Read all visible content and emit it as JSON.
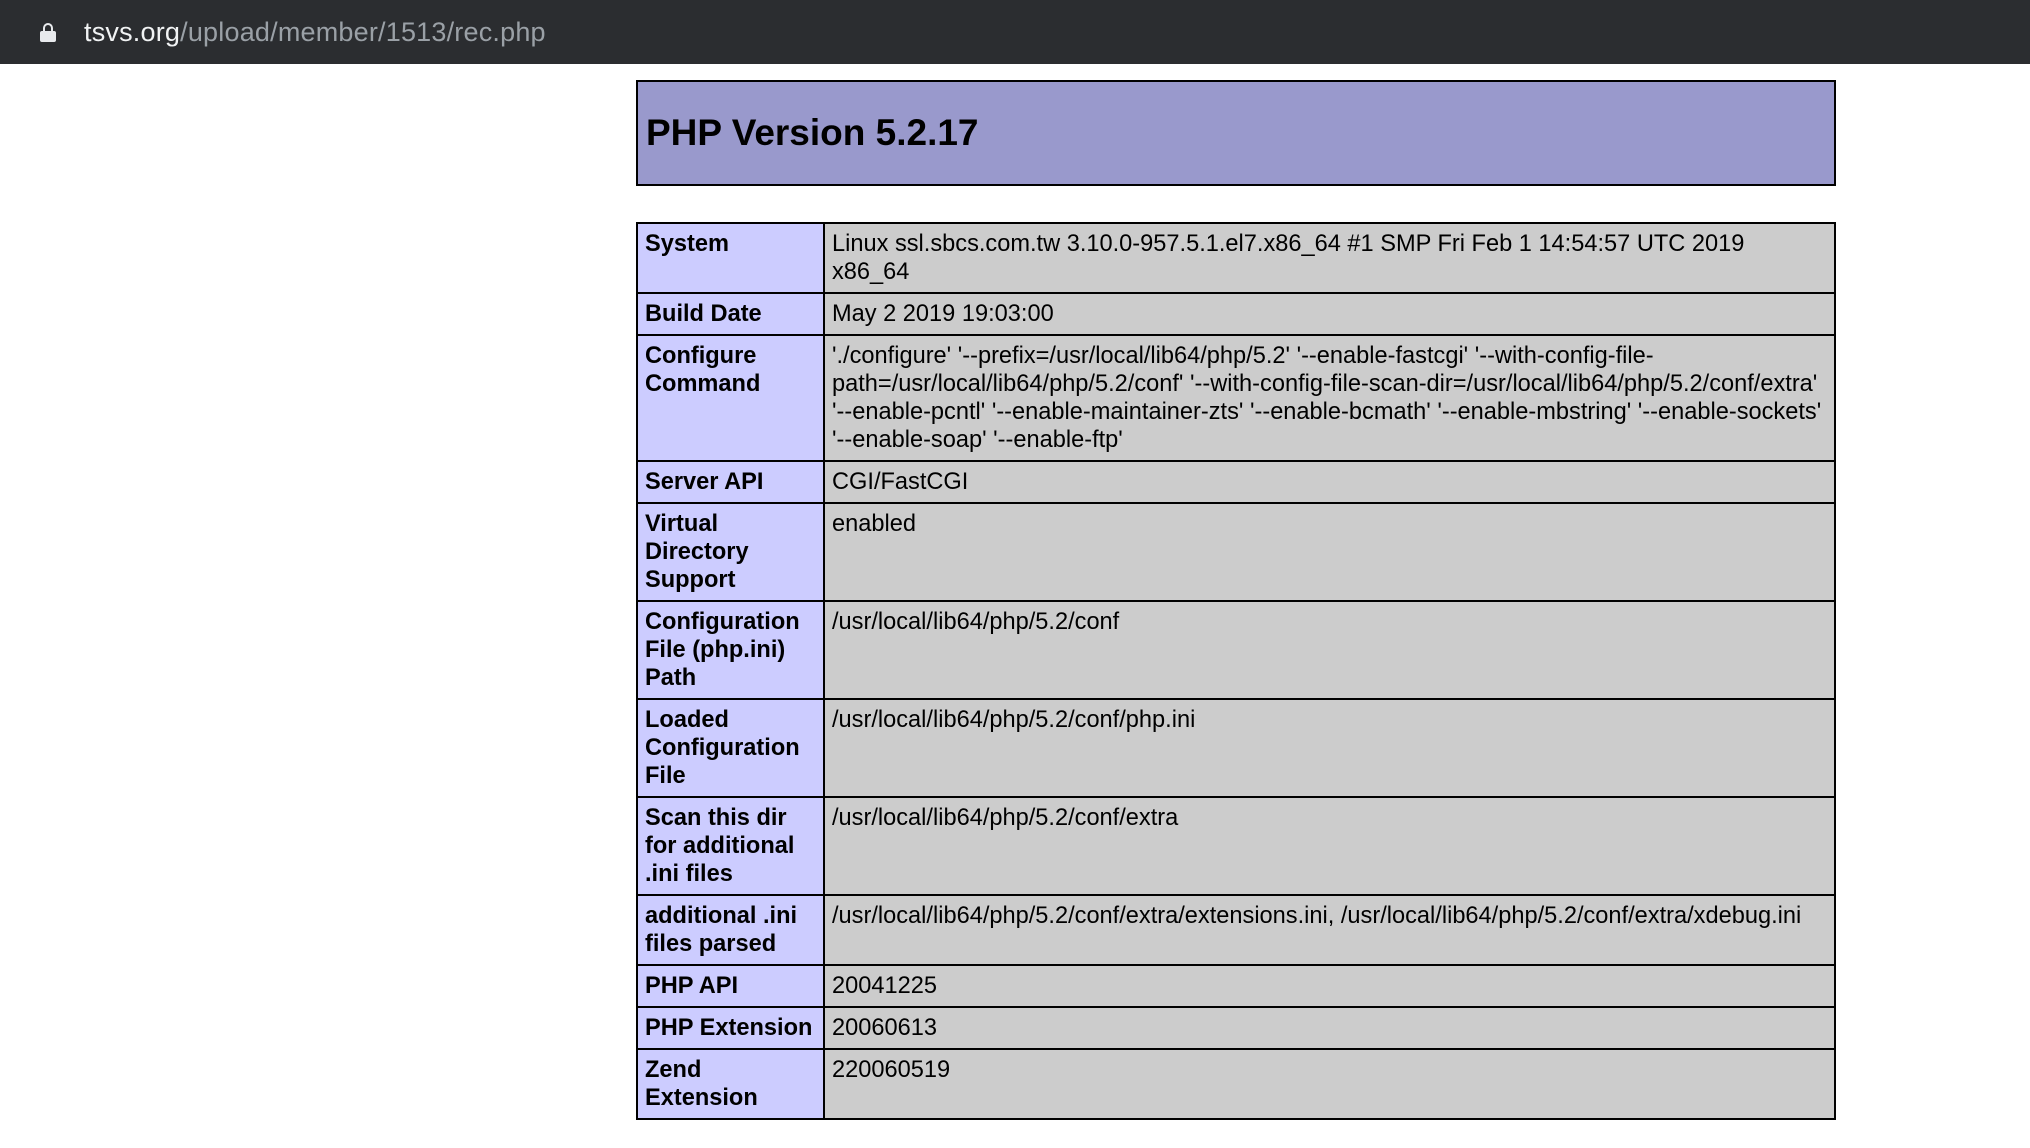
{
  "browser": {
    "url_host": "tsvs.org",
    "url_path": "/upload/member/1513/rec.php"
  },
  "page": {
    "title": "PHP Version 5.2.17"
  },
  "rows": [
    {
      "key": "System",
      "value": "Linux ssl.sbcs.com.tw 3.10.0-957.5.1.el7.x86_64 #1 SMP Fri Feb 1 14:54:57 UTC 2019 x86_64"
    },
    {
      "key": "Build Date",
      "value": "May 2 2019 19:03:00"
    },
    {
      "key": "Configure Command",
      "value": "'./configure' '--prefix=/usr/local/lib64/php/5.2' '--enable-fastcgi' '--with-config-file-path=/usr/local/lib64/php/5.2/conf' '--with-config-file-scan-dir=/usr/local/lib64/php/5.2/conf/extra' '--enable-pcntl' '--enable-maintainer-zts' '--enable-bcmath' '--enable-mbstring' '--enable-sockets' '--enable-soap' '--enable-ftp'"
    },
    {
      "key": "Server API",
      "value": "CGI/FastCGI"
    },
    {
      "key": "Virtual Directory Support",
      "value": "enabled"
    },
    {
      "key": "Configuration File (php.ini) Path",
      "value": "/usr/local/lib64/php/5.2/conf"
    },
    {
      "key": "Loaded Configuration File",
      "value": "/usr/local/lib64/php/5.2/conf/php.ini"
    },
    {
      "key": "Scan this dir for additional .ini files",
      "value": "/usr/local/lib64/php/5.2/conf/extra"
    },
    {
      "key": "additional .ini files parsed",
      "value": "/usr/local/lib64/php/5.2/conf/extra/extensions.ini, /usr/local/lib64/php/5.2/conf/extra/xdebug.ini"
    },
    {
      "key": "PHP API",
      "value": "20041225"
    },
    {
      "key": "PHP Extension",
      "value": "20060613"
    },
    {
      "key": "Zend Extension",
      "value": "220060519"
    }
  ],
  "colors": {
    "header_bg": "#9999cc",
    "key_bg": "#ccccff",
    "value_bg": "#cccccc",
    "browser_bar": "#2b2d30"
  },
  "icons": {
    "address_bar": "lock-icon"
  }
}
